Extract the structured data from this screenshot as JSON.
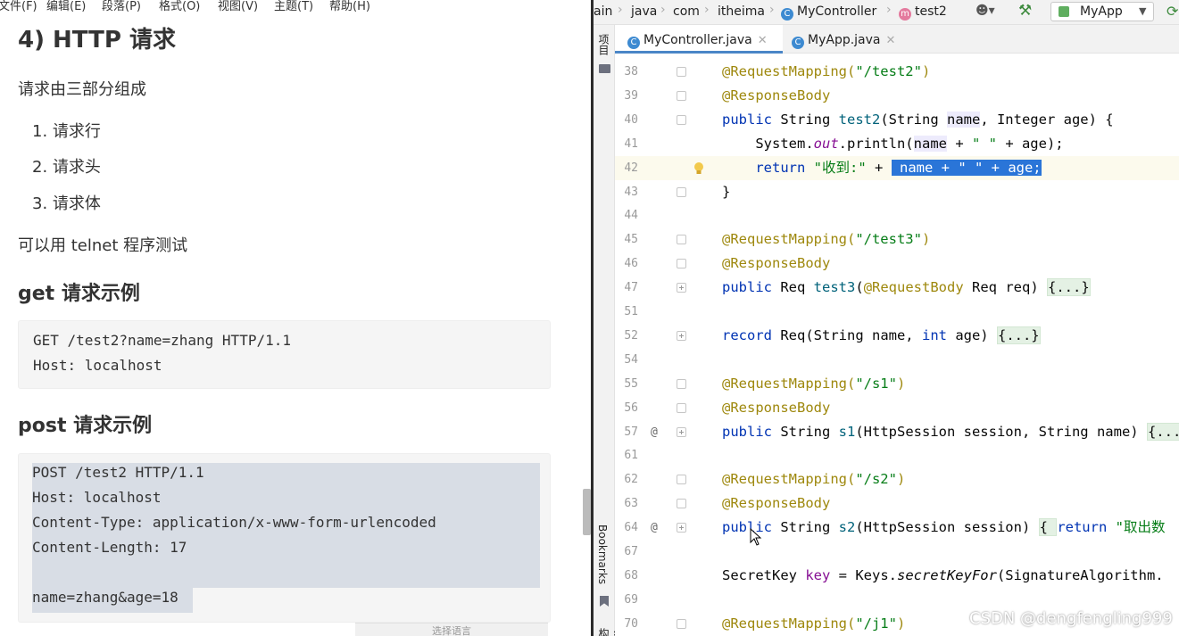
{
  "markdown": {
    "menu": [
      "文件(F)",
      "编辑(E)",
      "段落(P)",
      "格式(O)",
      "视图(V)",
      "主题(T)",
      "帮助(H)"
    ],
    "heading": "4) HTTP 请求",
    "intro": "请求由三部分组成",
    "list": [
      "1. 请求行",
      "2. 请求头",
      "3. 请求体"
    ],
    "telnet_note": "可以用 telnet 程序测试",
    "get_heading": "get 请求示例",
    "get_code": [
      "GET /test2?name=zhang HTTP/1.1",
      "Host: localhost"
    ],
    "post_heading": "post 请求示例",
    "post_code": [
      "POST /test2 HTTP/1.1",
      "Host: localhost",
      "Content-Type: application/x-www-form-urlencoded",
      "Content-Length: 17",
      "",
      "name=zhang&age=18"
    ],
    "lang_hint": "选择语言"
  },
  "ide": {
    "breadcrumb": [
      "ain",
      "java",
      "com",
      "itheima",
      "MyController",
      "test2"
    ],
    "run_config": "MyApp",
    "tool_windows": [
      "项目",
      "Bookmarks",
      "结构"
    ],
    "tabs": [
      {
        "label": "MyController.java",
        "active": true
      },
      {
        "label": "MyApp.java",
        "active": false
      }
    ],
    "line_numbers": [
      "38",
      "39",
      "40",
      "41",
      "42",
      "43",
      "44",
      "45",
      "46",
      "47",
      "51",
      "52",
      "54",
      "55",
      "56",
      "57",
      "61",
      "62",
      "63",
      "64",
      "67",
      "68",
      "69",
      "70"
    ],
    "caret_line": "42",
    "gutter_marks": {
      "57": "@",
      "64": "@"
    },
    "fold_markers": [
      "38",
      "39",
      "40",
      "43",
      "45",
      "46",
      "47",
      "52",
      "55",
      "56",
      "57",
      "62",
      "63",
      "64",
      "70"
    ],
    "code": {
      "l38": [
        "@RequestMapping(",
        "\"/test2\"",
        ")"
      ],
      "l39": "@ResponseBody",
      "l40": [
        "public",
        " String ",
        "test2",
        "(String ",
        "name",
        ", Integer age) {"
      ],
      "l41": [
        "    System.",
        "out",
        ".println(",
        "name",
        " + ",
        "\" \"",
        " + age);"
      ],
      "l42": [
        "    ",
        "return",
        " ",
        "\"收到:\"",
        " + ",
        " name + \" \" + age;"
      ],
      "l43": "}",
      "l45": [
        "@RequestMapping(",
        "\"/test3\"",
        ")"
      ],
      "l46": "@ResponseBody",
      "l47": [
        "public",
        " Req ",
        "test3",
        "(",
        "@RequestBody",
        " Req req) ",
        "{...}"
      ],
      "l52": [
        "record",
        " Req(String name, ",
        "int",
        " age) ",
        "{...}"
      ],
      "l55": [
        "@RequestMapping(",
        "\"/s1\"",
        ")"
      ],
      "l56": "@ResponseBody",
      "l57": [
        "public",
        " String ",
        "s1",
        "(HttpSession session, String name) ",
        "{..."
      ],
      "l62": [
        "@RequestMapping(",
        "\"/s2\"",
        ")"
      ],
      "l63": "@ResponseBody",
      "l64": [
        "public",
        " String ",
        "s2",
        "(HttpSession session) ",
        "{ ",
        "return",
        " ",
        "\"取出数"
      ],
      "l68": [
        "SecretKey ",
        "key",
        " = Keys.",
        "secretKeyFor",
        "(SignatureAlgorithm."
      ],
      "l70": [
        "@RequestMapping(",
        "\"/j1\"",
        ")"
      ]
    }
  },
  "watermark": "CSDN @dengfengling999",
  "colors": {
    "annotation": "#9e880d",
    "keyword": "#0033b3",
    "string": "#067d17",
    "selection": "#2a75d8",
    "accent_tab": "#4a86c7"
  }
}
